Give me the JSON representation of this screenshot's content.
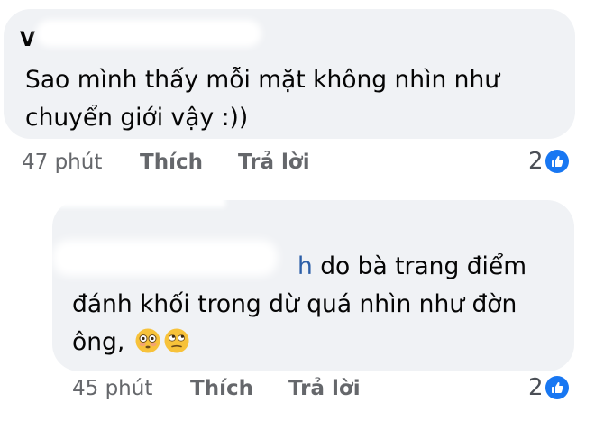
{
  "comments": [
    {
      "author_visible": "V",
      "text_line_1": "Sao mình thấy mỗi mặt không nhìn như",
      "text_line_2": "chuyển giới vậy :))",
      "time": "47 phút",
      "like_action": "Thích",
      "reply_action": "Trả lời",
      "reaction_count": "2",
      "reaction_icon": "thumbs-up-icon"
    },
    {
      "author_tail_visible": "h",
      "text_line_1": " do bà trang điểm",
      "text_line_2": "đánh khối trong dừ quá nhìn như đờn",
      "text_line_3": "ông,",
      "emojis": [
        "flushed-face-emoji",
        "eye-roll-emoji"
      ],
      "time": "45 phút",
      "like_action": "Thích",
      "reply_action": "Trả lời",
      "reaction_count": "2",
      "reaction_icon": "thumbs-up-icon"
    }
  ],
  "colors": {
    "bubble_bg": "#f0f2f5",
    "text": "#050505",
    "meta": "#65676b",
    "link_name": "#2d5fa8",
    "like_blue": "#1877f2"
  }
}
